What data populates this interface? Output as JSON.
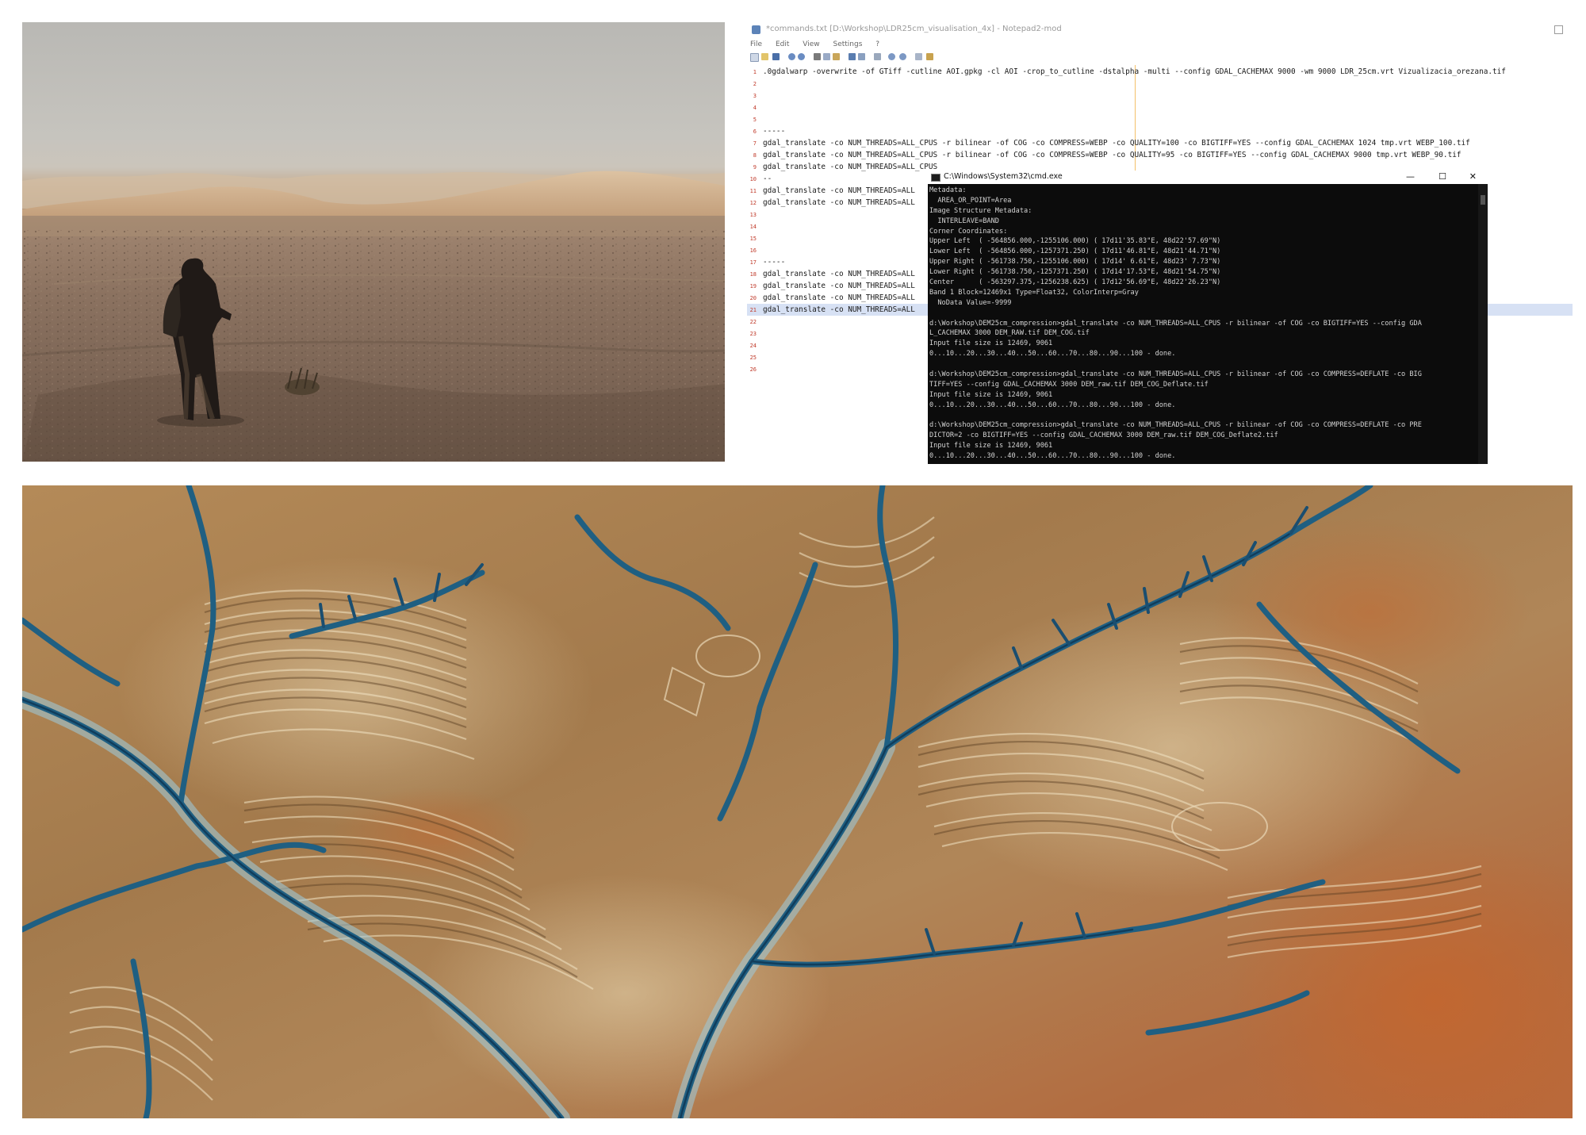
{
  "notepad": {
    "title": "*commands.txt [D:\\Workshop\\LDR25cm_visualisation_4x] - Notepad2-mod",
    "menu": [
      "File",
      "Edit",
      "View",
      "Settings",
      "?"
    ],
    "lines": [
      {
        "n": "1",
        "text": ".0gdalwarp -overwrite -of GTiff -cutline AOI.gpkg -cl AOI -crop_to_cutline -dstalpha -multi --config GDAL_CACHEMAX 9000 -wm 9000 LDR_25cm.vrt Vizualizacia_orezana.tif"
      },
      {
        "n": "2",
        "text": ""
      },
      {
        "n": "3",
        "text": ""
      },
      {
        "n": "4",
        "text": ""
      },
      {
        "n": "5",
        "text": ""
      },
      {
        "n": "6",
        "text": "-----"
      },
      {
        "n": "7",
        "text": "gdal_translate -co NUM_THREADS=ALL_CPUS -r bilinear -of COG -co COMPRESS=WEBP -co QUALITY=100 -co BIGTIFF=YES --config GDAL_CACHEMAX 1024 tmp.vrt WEBP_100.tif"
      },
      {
        "n": "8",
        "text": "gdal_translate -co NUM_THREADS=ALL_CPUS -r bilinear -of COG -co COMPRESS=WEBP -co QUALITY=95 -co BIGTIFF=YES --config GDAL_CACHEMAX 9000 tmp.vrt WEBP_90.tif"
      },
      {
        "n": "9",
        "text": "gdal_translate -co NUM_THREADS=ALL_CPUS"
      },
      {
        "n": "10",
        "text": "--"
      },
      {
        "n": "11",
        "text": "gdal_translate -co NUM_THREADS=ALL"
      },
      {
        "n": "12",
        "text": "gdal_translate -co NUM_THREADS=ALL                                                                                                                        2.tif"
      },
      {
        "n": "13",
        "text": ""
      },
      {
        "n": "14",
        "text": ""
      },
      {
        "n": "15",
        "text": ""
      },
      {
        "n": "16",
        "text": ""
      },
      {
        "n": "17",
        "text": "-----"
      },
      {
        "n": "18",
        "text": "gdal_translate -co NUM_THREADS=ALL"
      },
      {
        "n": "19",
        "text": "gdal_translate -co NUM_THREADS=ALL"
      },
      {
        "n": "20",
        "text": "gdal_translate -co NUM_THREADS=ALL                                                                                                               Deflate2.tif"
      },
      {
        "n": "21",
        "text": "gdal_translate -co NUM_THREADS=ALL                                                                                                            fig GDAL_CACHEMAX"
      },
      {
        "n": "22",
        "text": ""
      },
      {
        "n": "23",
        "text": ""
      },
      {
        "n": "24",
        "text": ""
      },
      {
        "n": "25",
        "text": ""
      },
      {
        "n": "26",
        "text": ""
      }
    ]
  },
  "cmd": {
    "title": "C:\\Windows\\System32\\cmd.exe",
    "minimize": "—",
    "maximize": "☐",
    "close": "✕",
    "lines": [
      "Metadata:",
      "  AREA_OR_POINT=Area",
      "Image Structure Metadata:",
      "  INTERLEAVE=BAND",
      "Corner Coordinates:",
      "Upper Left  ( -564856.000,-1255106.000) ( 17d11'35.83\"E, 48d22'57.69\"N)",
      "Lower Left  ( -564856.000,-1257371.250) ( 17d11'46.81\"E, 48d21'44.71\"N)",
      "Upper Right ( -561738.750,-1255106.000) ( 17d14' 6.61\"E, 48d23' 7.73\"N)",
      "Lower Right ( -561738.750,-1257371.250) ( 17d14'17.53\"E, 48d21'54.75\"N)",
      "Center      ( -563297.375,-1256238.625) ( 17d12'56.69\"E, 48d22'26.23\"N)",
      "Band 1 Block=12469x1 Type=Float32, ColorInterp=Gray",
      "  NoData Value=-9999",
      "",
      "d:\\Workshop\\DEM25cm_compression>gdal_translate -co NUM_THREADS=ALL_CPUS -r bilinear -of COG -co BIGTIFF=YES --config GDA",
      "L_CACHEMAX 3000 DEM_RAW.tif DEM_COG.tif",
      "Input file size is 12469, 9061",
      "0...10...20...30...40...50...60...70...80...90...100 - done.",
      "",
      "d:\\Workshop\\DEM25cm_compression>gdal_translate -co NUM_THREADS=ALL_CPUS -r bilinear -of COG -co COMPRESS=DEFLATE -co BIG",
      "TIFF=YES --config GDAL_CACHEMAX 3000 DEM_raw.tif DEM_COG_Deflate.tif",
      "Input file size is 12469, 9061",
      "0...10...20...30...40...50...60...70...80...90...100 - done.",
      "",
      "d:\\Workshop\\DEM25cm_compression>gdal_translate -co NUM_THREADS=ALL_CPUS -r bilinear -of COG -co COMPRESS=DEFLATE -co PRE",
      "DICTOR=2 -co BIGTIFF=YES --config GDAL_CACHEMAX 3000 DEM_raw.tif DEM_COG_Deflate2.tif",
      "Input file size is 12469, 9061",
      "0...10...20...30...40...50...60...70...80...90...100 - done."
    ]
  },
  "colors": {
    "line_number": "#c03a2a",
    "selection": "#d7e1f4",
    "console_bg": "#0c0c0c",
    "console_text": "#d4d4d4",
    "relief_channel": "#1f5f82",
    "relief_ochre": "#b88a4e",
    "relief_rust": "#b8683a"
  },
  "icons": [
    "notepad-app-icon",
    "cmd-app-icon",
    "toolbar-icons"
  ]
}
